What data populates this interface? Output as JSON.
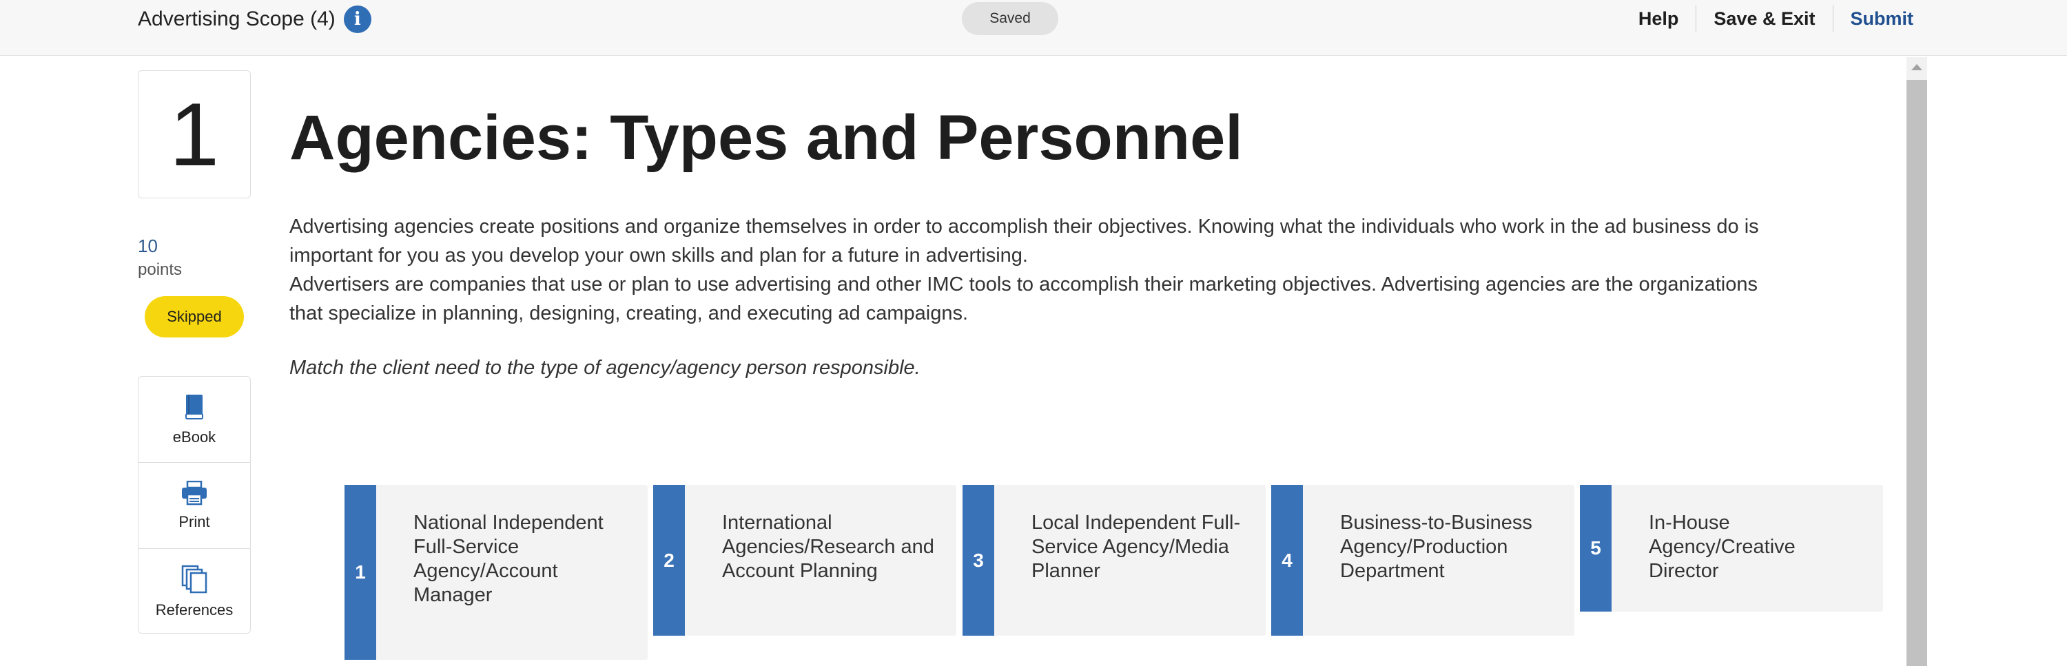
{
  "header": {
    "title": "Advertising Scope (4)",
    "info_icon": "info-icon",
    "status": "Saved",
    "links": {
      "help": "Help",
      "save_exit": "Save & Exit",
      "submit": "Submit"
    }
  },
  "question": {
    "number": "1",
    "points_value": "10",
    "points_label": "points",
    "status_badge": "Skipped",
    "title": "Agencies: Types and Personnel",
    "paragraphs": [
      "Advertising agencies create positions and organize themselves in order to accomplish their objectives. Knowing what the individuals who work in the ad business do is important for you as you develop your own skills and plan for a future in advertising.",
      "Advertisers are companies that use or plan to use advertising and other IMC tools to accomplish their marketing objectives. Advertising agencies are the organizations that specialize in planning, designing, creating, and executing ad campaigns."
    ],
    "instruction": "Match the client need to the type of agency/agency person responsible."
  },
  "tools": [
    {
      "label": "eBook",
      "icon": "book-icon"
    },
    {
      "label": "Print",
      "icon": "printer-icon"
    },
    {
      "label": "References",
      "icon": "documents-icon"
    }
  ],
  "options": [
    {
      "number": "1",
      "text": "National Independent Full-Service Agency/Account Manager"
    },
    {
      "number": "2",
      "text": "International Agencies/Research and Account Planning"
    },
    {
      "number": "3",
      "text": "Local Independent Full-Service Agency/Media Planner"
    },
    {
      "number": "4",
      "text": "Business-to-Business Agency/Production Department"
    },
    {
      "number": "5",
      "text": "In-House Agency/Creative Director"
    }
  ],
  "colors": {
    "accent_blue": "#3a72b7",
    "link_blue": "#1f4f8f",
    "badge_yellow": "#f6d70f",
    "info_blue": "#2f6db5"
  }
}
